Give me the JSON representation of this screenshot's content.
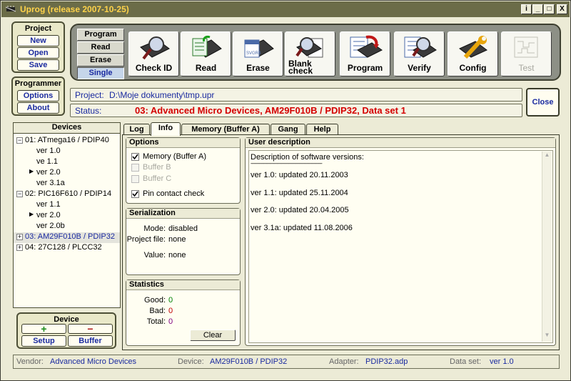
{
  "window": {
    "title": "Uprog (release 2007-10-25)",
    "controls": [
      "i",
      "_",
      "□",
      "X"
    ]
  },
  "project_panel": {
    "title": "Project",
    "buttons": [
      "New",
      "Open",
      "Save"
    ]
  },
  "programmer_panel": {
    "title": "Programmer",
    "buttons": [
      "Options",
      "About"
    ]
  },
  "mode_buttons": [
    {
      "label": "Program",
      "active": false
    },
    {
      "label": "Read",
      "active": false
    },
    {
      "label": "Erase",
      "active": false
    },
    {
      "label": "Single",
      "active": true
    }
  ],
  "toolbar": [
    {
      "label": "Check ID",
      "icon": "chip-magnifier-icon",
      "enabled": true
    },
    {
      "label": "Read",
      "icon": "chip-read-icon",
      "enabled": true
    },
    {
      "label": "Erase",
      "icon": "chip-erase-icon",
      "enabled": true
    },
    {
      "label": "Blank check",
      "icon": "chip-blank-check-icon",
      "enabled": true
    },
    {
      "label": "Program",
      "icon": "chip-program-icon",
      "enabled": true
    },
    {
      "label": "Verify",
      "icon": "chip-verify-icon",
      "enabled": true
    },
    {
      "label": "Config",
      "icon": "chip-config-icon",
      "enabled": true
    },
    {
      "label": "Test",
      "icon": "chip-test-icon",
      "enabled": false
    }
  ],
  "toolbar_chip_logo": "SVGR4",
  "project_bar": {
    "label": "Project:",
    "value": "D:\\Moje dokumenty\\tmp.upr"
  },
  "status_bar": {
    "label": "Status:",
    "value": "03: Advanced Micro Devices, AM29F010B / PDIP32, Data set 1"
  },
  "close_button": "Close",
  "devices": {
    "title": "Devices",
    "items": [
      {
        "text": "01: ATmega16 / PDIP40",
        "level": 0,
        "expander": "−",
        "selected": false
      },
      {
        "text": "ver 1.0",
        "level": 1,
        "selected": false
      },
      {
        "text": "ve 1.1",
        "level": 1,
        "selected": false
      },
      {
        "text": "ver 2.0",
        "level": 1,
        "marker": "▶",
        "selected": false
      },
      {
        "text": "ver 3.1a",
        "level": 1,
        "selected": false
      },
      {
        "text": "02: PIC16F610 / PDIP14",
        "level": 0,
        "expander": "−",
        "selected": false
      },
      {
        "text": "ver 1.1",
        "level": 1,
        "selected": false
      },
      {
        "text": "ver 2.0",
        "level": 1,
        "marker": "▶",
        "selected": false
      },
      {
        "text": "ver 2.0b",
        "level": 1,
        "selected": false
      },
      {
        "text": "03: AM29F010B / PDIP32",
        "level": 0,
        "expander": "+",
        "selected": true
      },
      {
        "text": "04: 27C128 / PLCC32",
        "level": 0,
        "expander": "+",
        "selected": false
      }
    ]
  },
  "device_panel": {
    "title": "Device",
    "add_icon": "+",
    "remove_icon": "−",
    "setup": "Setup",
    "buffer": "Buffer"
  },
  "tabs": [
    {
      "label": "Log",
      "active": false
    },
    {
      "label": "Info",
      "active": true
    },
    {
      "label": "Memory (Buffer A)",
      "active": false
    },
    {
      "label": "Gang",
      "active": false
    },
    {
      "label": "Help",
      "active": false
    }
  ],
  "options": {
    "title": "Options",
    "items": [
      {
        "label": "Memory (Buffer A)",
        "checked": true,
        "enabled": true
      },
      {
        "label": "Buffer B",
        "checked": false,
        "enabled": false
      },
      {
        "label": "Buffer C",
        "checked": false,
        "enabled": false
      },
      {
        "label": "Pin contact check",
        "checked": true,
        "enabled": true
      }
    ]
  },
  "serialization": {
    "title": "Serialization",
    "mode_label": "Mode:",
    "mode_value": "disabled",
    "project_file_label": "Project file:",
    "project_file_value": "none",
    "value_label": "Value:",
    "value_value": "none"
  },
  "statistics": {
    "title": "Statistics",
    "good_label": "Good:",
    "good_value": "0",
    "bad_label": "Bad:",
    "bad_value": "0",
    "total_label": "Total:",
    "total_value": "0",
    "clear_button": "Clear"
  },
  "user_description": {
    "title": "User description",
    "heading": "Description of software versions:",
    "separator": "------------------------------------------------------------",
    "lines": [
      "ver 1.0: updated  20.11.2003",
      "ver 1.1: updated  25.11.2004",
      "ver 2.0: updated  20.04.2005",
      "ver 3.1a: updated  11.08.2006"
    ]
  },
  "footer": {
    "vendor_label": "Vendor:",
    "vendor_value": "Advanced Micro Devices",
    "device_label": "Device:",
    "device_value": "AM29F010B / PDIP32",
    "adapter_label": "Adapter:",
    "adapter_value": "PDIP32.adp",
    "dataset_label": "Data set:",
    "dataset_value": "ver 1.0"
  },
  "colors": {
    "title_bar": "#6b6c48",
    "title_text": "#ffd34a",
    "status_red": "#d40000",
    "label_blue": "#1a2aa0",
    "good_green": "#008000",
    "bad_red": "#c00000",
    "total_purple": "#800080"
  }
}
